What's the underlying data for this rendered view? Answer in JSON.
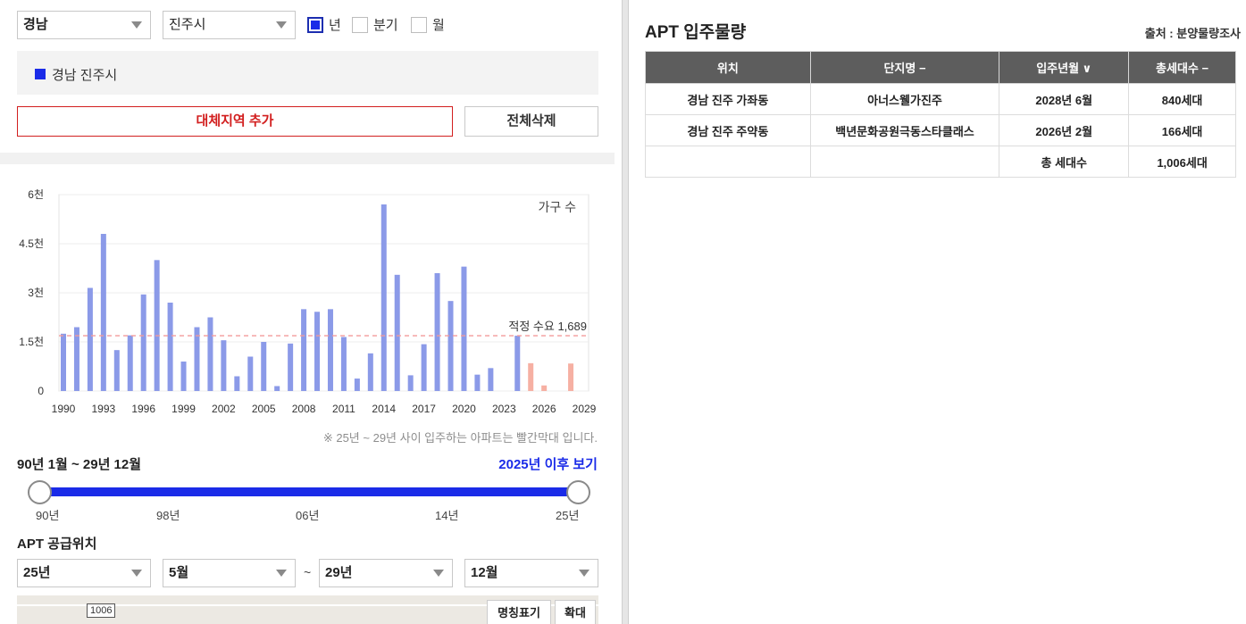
{
  "filters": {
    "province": "경남",
    "city": "진주시",
    "period_options": [
      {
        "label": "년",
        "checked": true
      },
      {
        "label": "분기",
        "checked": false
      },
      {
        "label": "월",
        "checked": false
      }
    ]
  },
  "selected_region": {
    "label": "경남 진주시",
    "color": "#1a2be8"
  },
  "buttons": {
    "add_region": "대체지역 추가",
    "delete_all": "전체삭제"
  },
  "chart_data": {
    "type": "bar",
    "series_label": "가구 수",
    "y_ticks": [
      "6천",
      "4.5천",
      "3천",
      "1.5천",
      "0"
    ],
    "ylim": [
      0,
      6000
    ],
    "x_ticks": [
      "1990",
      "1993",
      "1996",
      "1999",
      "2002",
      "2005",
      "2008",
      "2011",
      "2014",
      "2017",
      "2020",
      "2023",
      "2026",
      "2029"
    ],
    "x": [
      1990,
      1991,
      1992,
      1993,
      1994,
      1995,
      1996,
      1997,
      1998,
      1999,
      2000,
      2001,
      2002,
      2003,
      2004,
      2005,
      2006,
      2007,
      2008,
      2009,
      2010,
      2011,
      2012,
      2013,
      2014,
      2015,
      2016,
      2017,
      2018,
      2019,
      2020,
      2021,
      2022,
      2023,
      2024,
      2025,
      2026,
      2027,
      2028,
      2029
    ],
    "values": [
      1750,
      1950,
      3150,
      4800,
      1250,
      1700,
      2950,
      4000,
      2700,
      900,
      1950,
      2250,
      1550,
      450,
      1050,
      1500,
      150,
      1450,
      2500,
      2420,
      2500,
      1650,
      380,
      1150,
      5700,
      3550,
      480,
      1430,
      3600,
      2750,
      3800,
      500,
      700,
      0,
      1689,
      850,
      170,
      0,
      840,
      0
    ],
    "future_color": "#f6b0a3",
    "past_color": "#8b9ae8",
    "reference": {
      "label": "적정 수요 1,689",
      "value": 1689,
      "color": "#f39a9a"
    },
    "grid": true
  },
  "chart_note": "※ 25년 ~ 29년 사이 입주하는 아파트는 빨간막대 입니다.",
  "range": {
    "label": "90년 1월 ~ 29년 12월",
    "after_link": "2025년 이후 보기",
    "ticks": [
      "90년",
      "98년",
      "06년",
      "14년",
      "25년"
    ]
  },
  "supply": {
    "title": "APT 공급위치",
    "from_year": "25년",
    "from_month": "5월",
    "separator": "~",
    "to_year": "29년",
    "to_month": "12월"
  },
  "map": {
    "road_badge": "1006",
    "label_button": "명칭표기",
    "zoom_button": "확대"
  },
  "table": {
    "title": "APT 입주물량",
    "source": "출처 : 분양물량조사",
    "headers": [
      "위치",
      "단지명 −",
      "입주년월 ∨",
      "총세대수 −"
    ],
    "rows": [
      [
        "경남 진주 가좌동",
        "아너스웰가진주",
        "2028년 6월",
        "840세대"
      ],
      [
        "경남 진주 주약동",
        "백년문화공원극동스타클래스",
        "2026년 2월",
        "166세대"
      ]
    ],
    "total_label": "총 세대수",
    "total_value": "1,006세대"
  }
}
